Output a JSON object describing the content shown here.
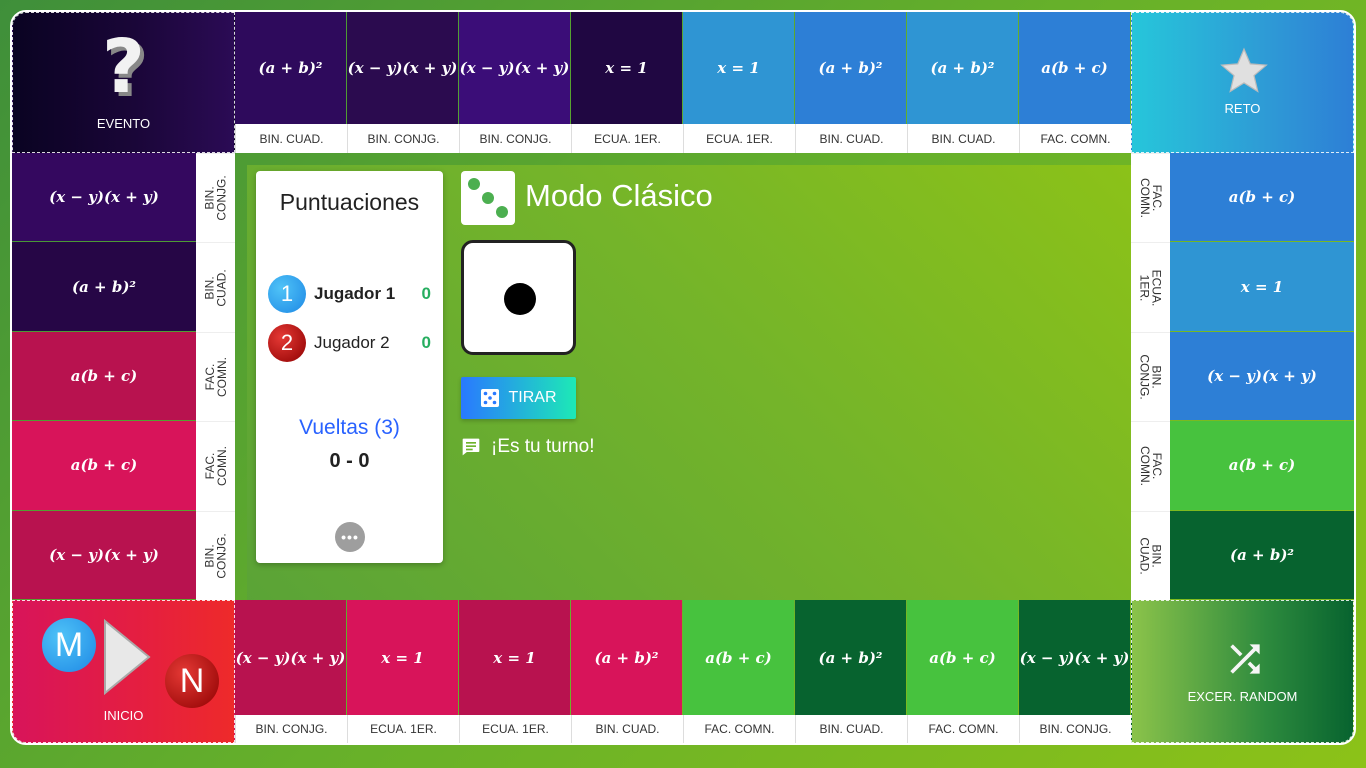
{
  "corners": {
    "evento": {
      "label": "EVENTO",
      "icon": "question-mark-icon",
      "glyph": "?"
    },
    "reto": {
      "label": "RETO",
      "icon": "star-icon"
    },
    "inicio": {
      "label": "INICIO",
      "icon": "play-arrow-icon",
      "token_m": "M",
      "token_n": "N"
    },
    "random": {
      "label": "EXCER. RANDOM",
      "icon": "shuffle-icon"
    }
  },
  "top_row": [
    {
      "expr": "(a + b)²",
      "label": "BIN. CUAD.",
      "color": "#2e0a5c"
    },
    {
      "expr": "(x − y)(x + y)",
      "label": "BIN. CONJG.",
      "color": "#2b0b4f"
    },
    {
      "expr": "(x − y)(x + y)",
      "label": "BIN. CONJG.",
      "color": "#3b0d78"
    },
    {
      "expr": "x = 1",
      "label": "ECUA. 1ER.",
      "color": "#200742"
    },
    {
      "expr": "x = 1",
      "label": "ECUA. 1ER.",
      "color": "#2f95d3"
    },
    {
      "expr": "(a + b)²",
      "label": "BIN. CUAD.",
      "color": "#2d7fd6"
    },
    {
      "expr": "(a + b)²",
      "label": "BIN. CUAD.",
      "color": "#2f95d3"
    },
    {
      "expr": "a(b + c)",
      "label": "FAC. COMN.",
      "color": "#2d7fd6"
    }
  ],
  "left_col": [
    {
      "expr": "(x − y)(x + y)",
      "label": "BIN.\nCONJG.",
      "color": "#34085f"
    },
    {
      "expr": "(a + b)²",
      "label": "BIN.\nCUAD.",
      "color": "#260646"
    },
    {
      "expr": "a(b + c)",
      "label": "FAC.\nCOMN.",
      "color": "#b8124f"
    },
    {
      "expr": "a(b + c)",
      "label": "FAC.\nCOMN.",
      "color": "#d8145a"
    },
    {
      "expr": "(x − y)(x + y)",
      "label": "BIN.\nCONJG.",
      "color": "#b8124f"
    }
  ],
  "right_col": [
    {
      "expr": "a(b + c)",
      "label": "FAC.\nCOMN.",
      "color": "#2d7fd6"
    },
    {
      "expr": "x = 1",
      "label": "ECUA.\n1ER.",
      "color": "#2f95d3"
    },
    {
      "expr": "(x − y)(x + y)",
      "label": "BIN.\nCONJG.",
      "color": "#2d7fd6"
    },
    {
      "expr": "a(b + c)",
      "label": "FAC.\nCOMN.",
      "color": "#47c23e"
    },
    {
      "expr": "(a + b)²",
      "label": "BIN.\nCUAD.",
      "color": "#07632f"
    }
  ],
  "bottom_row": [
    {
      "expr": "(x − y)(x + y)",
      "label": "BIN. CONJG.",
      "color": "#b8124f"
    },
    {
      "expr": "x = 1",
      "label": "ECUA. 1ER.",
      "color": "#d8145a"
    },
    {
      "expr": "x = 1",
      "label": "ECUA. 1ER.",
      "color": "#b8124f"
    },
    {
      "expr": "(a + b)²",
      "label": "BIN. CUAD.",
      "color": "#d8145a"
    },
    {
      "expr": "a(b + c)",
      "label": "FAC. COMN.",
      "color": "#47c23e"
    },
    {
      "expr": "(a + b)²",
      "label": "BIN. CUAD.",
      "color": "#07632f"
    },
    {
      "expr": "a(b + c)",
      "label": "FAC. COMN.",
      "color": "#47c23e"
    },
    {
      "expr": "(x − y)(x + y)",
      "label": "BIN. CONJG.",
      "color": "#07632f"
    }
  ],
  "scores": {
    "title": "Puntuaciones",
    "players": [
      {
        "number": "1",
        "name": "Jugador 1",
        "score": "0",
        "active": true,
        "color": "#29b6f6"
      },
      {
        "number": "2",
        "name": "Jugador 2",
        "score": "0",
        "active": false,
        "color": "#c62828"
      }
    ],
    "laps_title": "Vueltas (3)",
    "laps_score": "0 - 0",
    "more": "•••"
  },
  "game": {
    "mode_title": "Modo Clásico",
    "mode_icon": "dice-icon",
    "die_value": 1,
    "roll_label": "TIRAR",
    "turn_text": "¡Es tu turno!",
    "turn_icon": "message-icon"
  }
}
